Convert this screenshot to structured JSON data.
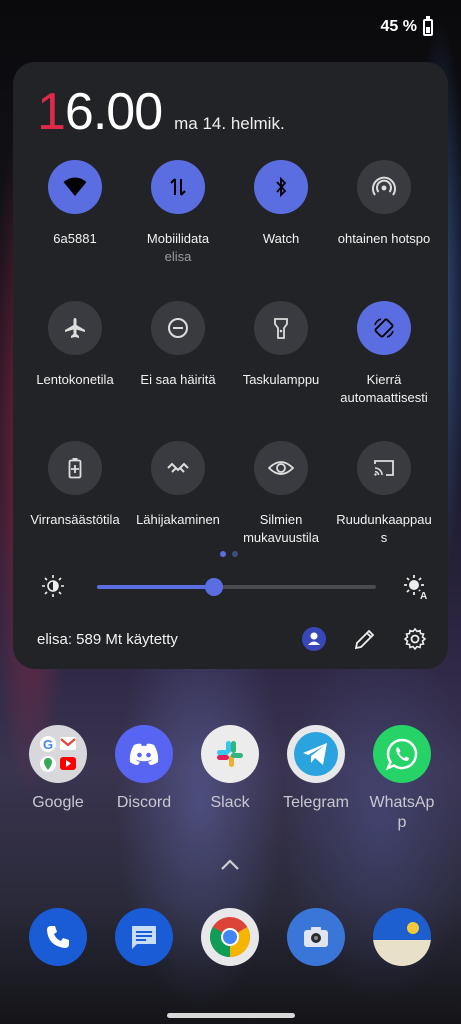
{
  "status": {
    "battery_text": "45 %"
  },
  "panel": {
    "clock_first": "1",
    "clock_rest": "6.00",
    "date": "ma 14. helmik.",
    "tiles": [
      {
        "label": "6a5881",
        "sub": "",
        "icon": "wifi-icon",
        "active": true
      },
      {
        "label": "Mobiilidata",
        "sub": "elisa",
        "icon": "mobile-data-icon",
        "active": true
      },
      {
        "label": "Watch",
        "sub": "",
        "icon": "bluetooth-icon",
        "active": true
      },
      {
        "label": "ohtainen hotspo",
        "sub": "",
        "icon": "hotspot-icon",
        "active": false
      },
      {
        "label": "Lentokonetila",
        "sub": "",
        "icon": "airplane-icon",
        "active": false
      },
      {
        "label": "Ei saa häiritä",
        "sub": "",
        "icon": "do-not-disturb-icon",
        "active": false
      },
      {
        "label": "Taskulamppu",
        "sub": "",
        "icon": "flashlight-icon",
        "active": false
      },
      {
        "label": "Kierrä",
        "sub": "automaattisesti",
        "icon": "auto-rotate-icon",
        "active": true
      },
      {
        "label": "Virransäästötila",
        "sub": "",
        "icon": "battery-saver-icon",
        "active": false
      },
      {
        "label": "Lähijakaminen",
        "sub": "",
        "icon": "nearby-share-icon",
        "active": false
      },
      {
        "label": "Silmien",
        "sub": "mukavuustila",
        "icon": "eye-comfort-icon",
        "active": false
      },
      {
        "label": "Ruudunkaappau",
        "sub": "s",
        "icon": "screen-cast-icon",
        "active": false
      }
    ],
    "brightness": 0.42,
    "data_usage": "elisa: 589 Mt  käytetty"
  },
  "apps": [
    {
      "name": "Google",
      "icon": "google-folder-icon"
    },
    {
      "name": "Discord",
      "icon": "discord-icon"
    },
    {
      "name": "Slack",
      "icon": "slack-icon"
    },
    {
      "name": "Telegram",
      "icon": "telegram-icon"
    },
    {
      "name": "WhatsAp",
      "name2": "p",
      "icon": "whatsapp-icon"
    }
  ],
  "dock": [
    {
      "icon": "phone-icon"
    },
    {
      "icon": "messages-icon"
    },
    {
      "icon": "chrome-icon"
    },
    {
      "icon": "camera-icon"
    },
    {
      "icon": "weather-icon"
    }
  ],
  "colors": {
    "accent": "#5b6ee1",
    "panel": "#222327",
    "tile_off": "#3a3b40",
    "clock_red": "#e0284a"
  }
}
